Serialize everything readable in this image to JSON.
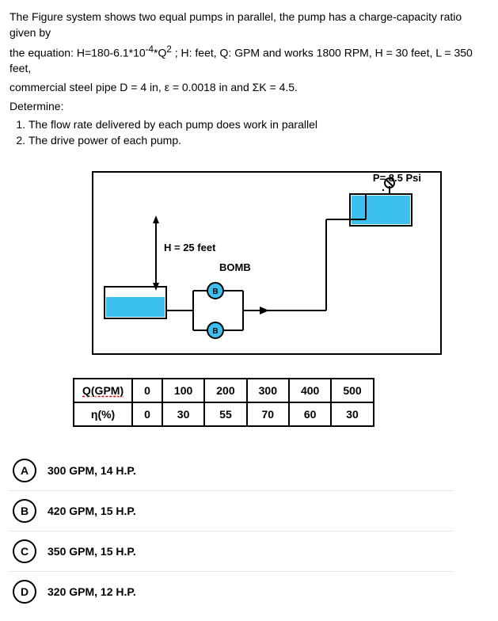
{
  "problem": {
    "line1": "The Figure system shows two equal pumps in parallel, the pump has a charge-capacity ratio given by",
    "line2_before": "the equation: H=180-6.1*10",
    "line2_sup": "-4",
    "line2_after": "*Q",
    "line2_sup2": "2",
    "line2_end": "  ; H: feet, Q: GPM and works 1800 RPM, H = 30 feet, L = 350 feet,",
    "line3": "commercial steel pipe D = 4 in, ε = 0.0018 in and ΣK = 4.5.",
    "line4": "Determine:",
    "item1": "The flow rate delivered by each pump does work in parallel",
    "item2": "The drive power of each pump."
  },
  "figure": {
    "h_label": "H = 25  feet",
    "bomb_label": "BOMB",
    "p_label": "P= 8.5 Psi",
    "b_label": "B"
  },
  "table": {
    "row1_label": "Q(GPM)",
    "row2_label": "η(%)",
    "cols": [
      "0",
      "100",
      "200",
      "300",
      "400",
      "500"
    ],
    "eta": [
      "0",
      "30",
      "55",
      "70",
      "60",
      "30"
    ]
  },
  "options": {
    "A": "300 GPM, 14 H.P.",
    "B": "420 GPM, 15 H.P.",
    "C": "350 GPM, 15 H.P.",
    "D": "320 GPM, 12 H.P."
  }
}
